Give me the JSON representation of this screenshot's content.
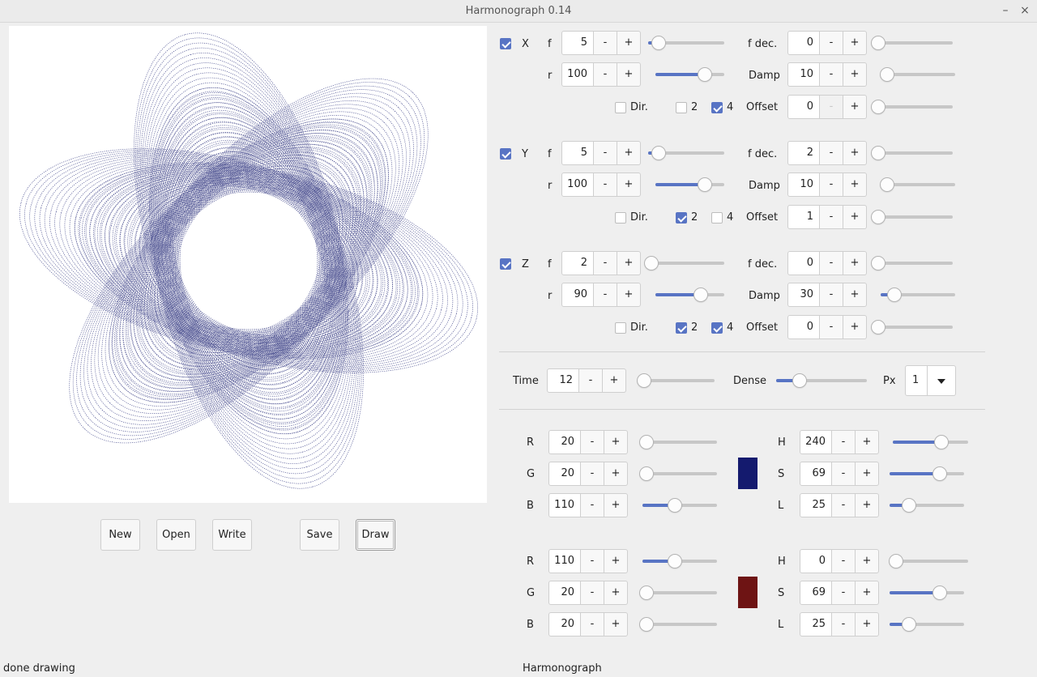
{
  "window": {
    "title": "Harmonograph 0.14",
    "minimize_glyph": "–",
    "close_glyph": "×"
  },
  "buttons": {
    "new": "New",
    "open": "Open",
    "write": "Write",
    "save": "Save",
    "draw": "Draw"
  },
  "status": {
    "left": "done drawing",
    "right": "Harmonograph"
  },
  "axes": [
    {
      "name": "X",
      "enabled": true,
      "f": "5",
      "f_level": 0.14,
      "fdec": "0",
      "fdec_level": 0.04,
      "r": "100",
      "r_level": 0.72,
      "damp": "10",
      "damp_level": 0.09,
      "dir": false,
      "two": false,
      "four": true,
      "offset": "0",
      "offset_level": 0.04,
      "offset_minus_disabled": true
    },
    {
      "name": "Y",
      "enabled": true,
      "f": "5",
      "f_level": 0.14,
      "fdec": "2",
      "fdec_level": 0.04,
      "r": "100",
      "r_level": 0.72,
      "damp": "10",
      "damp_level": 0.09,
      "dir": false,
      "two": true,
      "four": false,
      "offset": "1",
      "offset_level": 0.04,
      "offset_minus_disabled": false
    },
    {
      "name": "Z",
      "enabled": true,
      "f": "2",
      "f_level": 0.04,
      "fdec": "0",
      "fdec_level": 0.04,
      "r": "90",
      "r_level": 0.66,
      "damp": "30",
      "damp_level": 0.18,
      "dir": false,
      "two": true,
      "four": true,
      "offset": "0",
      "offset_level": 0.04,
      "offset_minus_disabled": false
    }
  ],
  "labels": {
    "f": "f",
    "r": "r",
    "fdec": "f dec.",
    "damp": "Damp",
    "dir": "Dir.",
    "two": "2",
    "four": "4",
    "offset": "Offset",
    "minus": "-",
    "plus": "+",
    "time": "Time",
    "dense": "Dense",
    "px": "Px"
  },
  "global": {
    "time": "12",
    "time_level": 0.04,
    "dense_level": 0.26,
    "px": "1"
  },
  "colors": [
    {
      "R": "20",
      "G": "20",
      "B": "110",
      "R_level": 0.05,
      "G_level": 0.05,
      "B_level": 0.43,
      "H": "240",
      "S": "69",
      "L": "25",
      "H_level": 0.65,
      "S_level": 0.67,
      "L_level": 0.26,
      "swatch": "#141a6e"
    },
    {
      "R": "110",
      "G": "20",
      "B": "20",
      "R_level": 0.43,
      "G_level": 0.05,
      "B_level": 0.05,
      "H": "0",
      "S": "69",
      "L": "25",
      "H_level": 0.04,
      "S_level": 0.67,
      "L_level": 0.26,
      "swatch": "#6e1414"
    }
  ],
  "color_labels": {
    "R": "R",
    "G": "G",
    "B": "B",
    "H": "H",
    "S": "S",
    "L": "L"
  },
  "drawing": {
    "stroke_color": "#141a6e"
  },
  "accent": "#5874c4"
}
